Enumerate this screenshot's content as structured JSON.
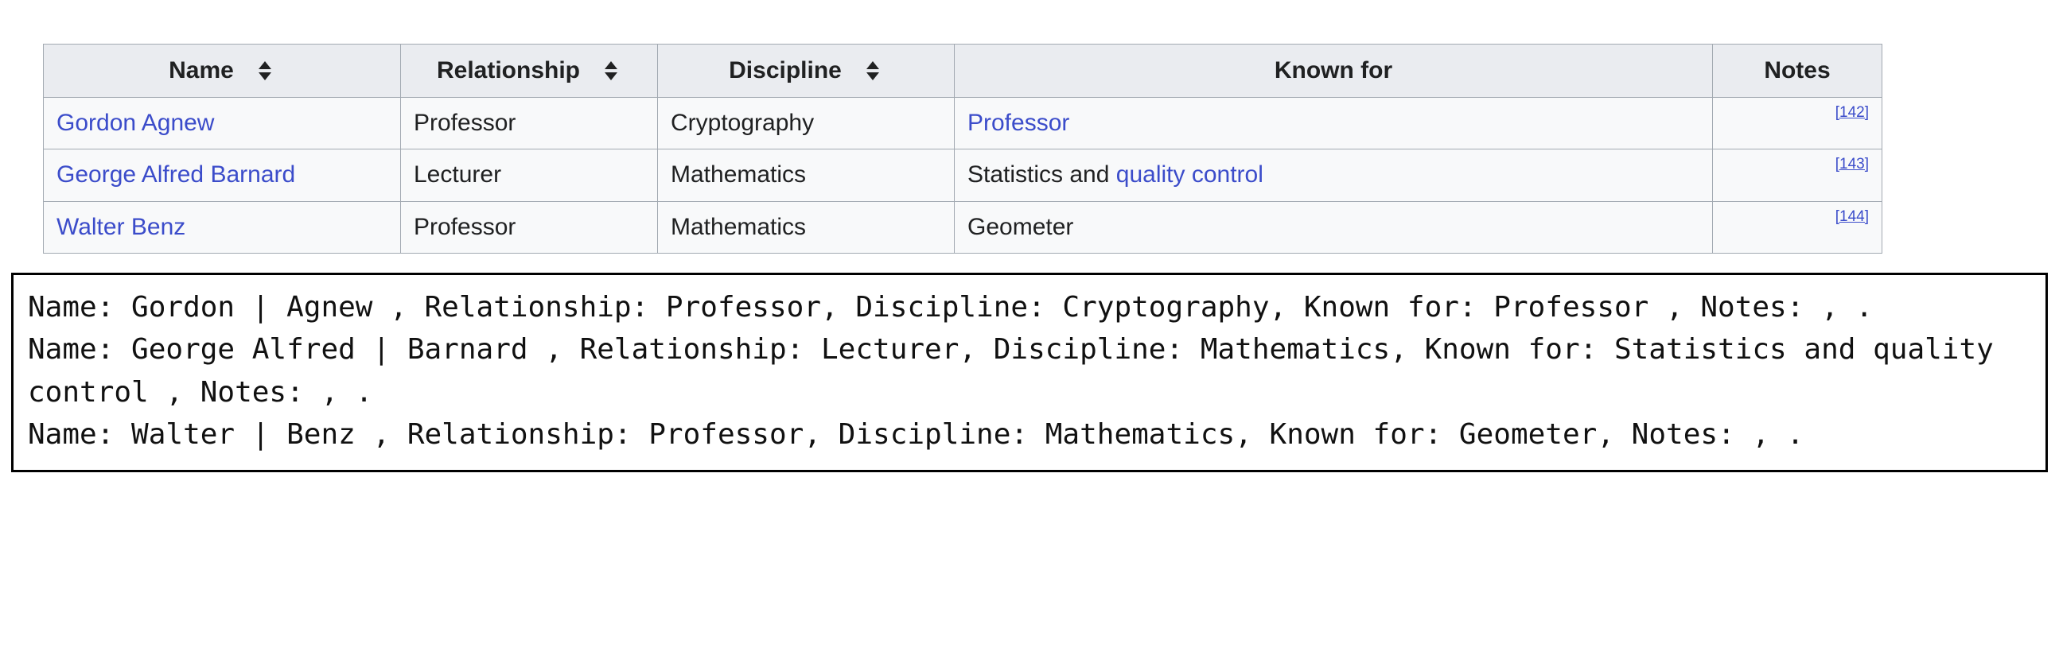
{
  "table": {
    "columns": [
      {
        "label": "Name",
        "sortable": true,
        "icon": "sort-arrows-icon"
      },
      {
        "label": "Relationship",
        "sortable": true,
        "icon": "sort-arrows-icon"
      },
      {
        "label": "Discipline",
        "sortable": true,
        "icon": "sort-arrows-icon"
      },
      {
        "label": "Known for",
        "sortable": true,
        "icon": "sort-arrows-icon"
      },
      {
        "label": "Notes",
        "sortable": false,
        "icon": ""
      }
    ],
    "rows": [
      {
        "name": "Gordon Agnew",
        "name_is_link": true,
        "relationship": "Professor",
        "discipline": "Cryptography",
        "known_for_plain": "",
        "known_for_link": "Professor",
        "note_ref": "[142]"
      },
      {
        "name": "George Alfred Barnard",
        "name_is_link": true,
        "relationship": "Lecturer",
        "discipline": "Mathematics",
        "known_for_plain": "Statistics and ",
        "known_for_link": "quality control",
        "note_ref": "[143]"
      },
      {
        "name": "Walter Benz",
        "name_is_link": true,
        "relationship": "Professor",
        "discipline": "Mathematics",
        "known_for_plain": "Geometer",
        "known_for_link": "",
        "note_ref": "[144]"
      }
    ]
  },
  "output": {
    "text": "Name: Gordon | Agnew , Relationship: Professor, Discipline: Cryptography, Known for: Professor , Notes: , .\nName: George Alfred | Barnard , Relationship: Lecturer, Discipline: Mathematics, Known for: Statistics and quality control , Notes: , .\nName: Walter | Benz , Relationship: Professor, Discipline: Mathematics, Known for: Geometer, Notes: , ."
  },
  "colors": {
    "link": "#3b4cca",
    "header_bg": "#eaecf0",
    "row_bg": "#f8f9fa",
    "border": "#a2a9b1",
    "text": "#202122"
  }
}
